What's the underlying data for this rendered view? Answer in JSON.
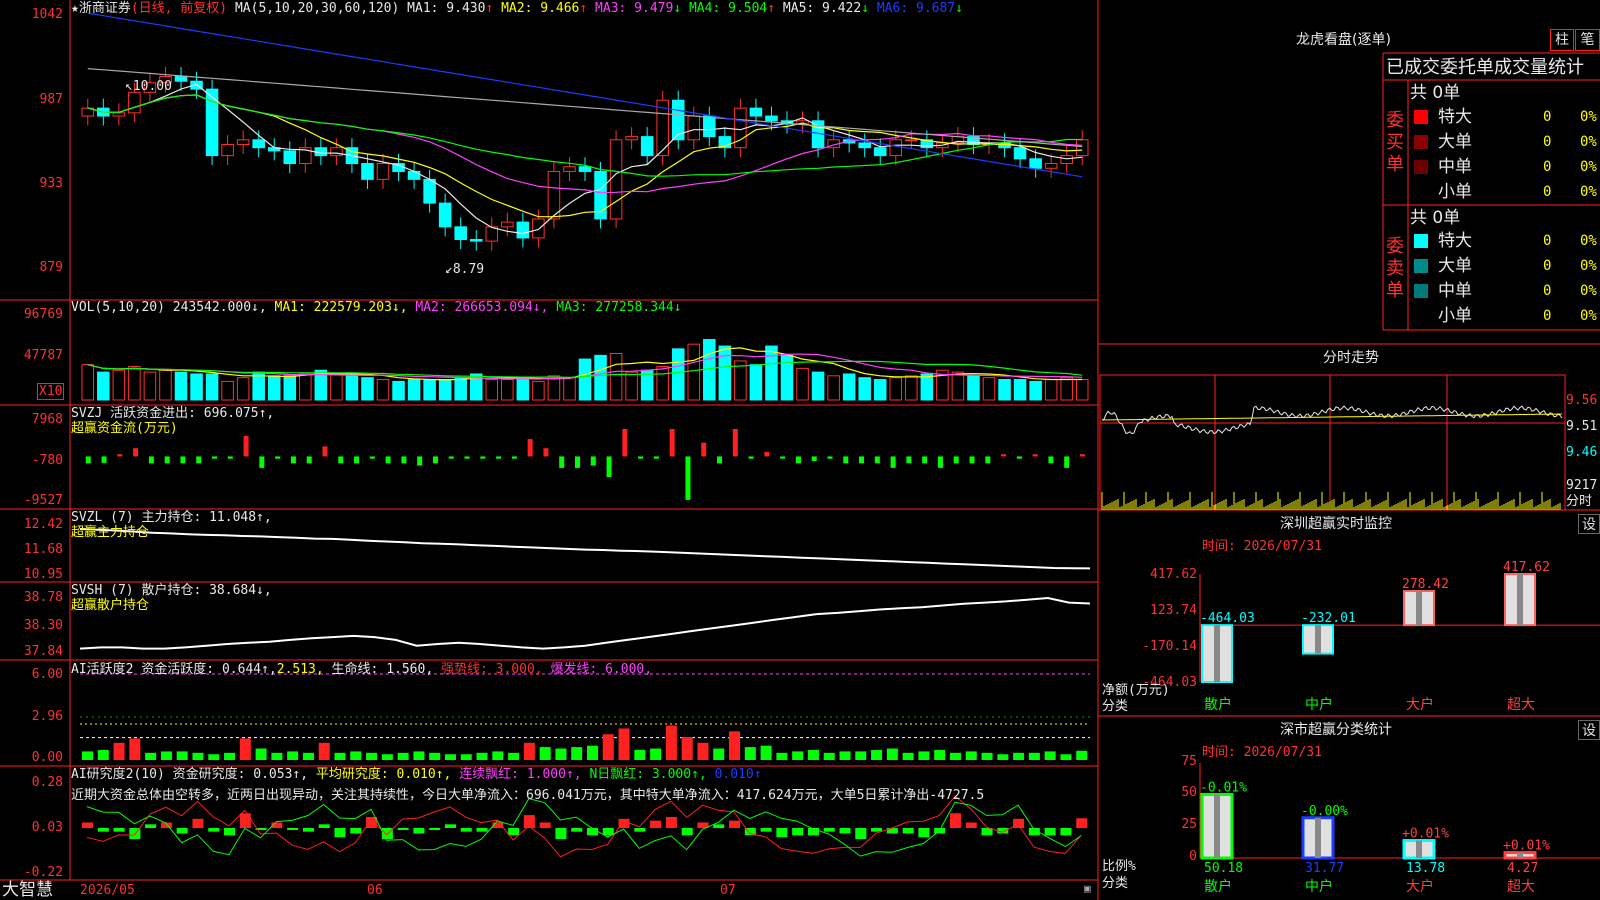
{
  "app": {
    "brand": "大智慧"
  },
  "chart": {
    "stock": "★浙商证券",
    "mode": "(日线, 前复权)",
    "ma_label": "MA(5,10,20,30,60,120)",
    "ma_values": [
      {
        "label": "MA1:",
        "value": "9.430",
        "dir": "↑"
      },
      {
        "label": "MA2:",
        "value": "9.466",
        "dir": "↑"
      },
      {
        "label": "MA3:",
        "value": "9.479",
        "dir": "↓"
      },
      {
        "label": "MA4:",
        "value": "9.504",
        "dir": "↑"
      },
      {
        "label": "MA5:",
        "value": "9.422",
        "dir": "↓"
      },
      {
        "label": "MA6:",
        "value": "9.687",
        "dir": "↓"
      }
    ],
    "price_axis": [
      "1042",
      "987",
      "933",
      "879"
    ],
    "high_marker": "10.00",
    "low_marker": "8.79",
    "date_labels": [
      "2026/05",
      "06",
      "07"
    ]
  },
  "vol": {
    "label": "VOL(5,10,20)",
    "value": "243542.000↓,",
    "ma1": "MA1: 222579.203↓,",
    "ma2": "MA2: 266653.094↓,",
    "ma3": "MA3: 277258.344↓",
    "axis": [
      "96769",
      "47787"
    ],
    "unit": "X10"
  },
  "svzj": {
    "label": "SVZJ  活跃资金进出: 696.075↑,",
    "sub": "超赢资金流(万元)",
    "axis": [
      "7968",
      "-780",
      "-9527"
    ]
  },
  "svzl": {
    "label": "SVZL (7) 主力持仓: 11.048↑,",
    "sub": "超赢主力持仓",
    "axis": [
      "12.42",
      "11.68",
      "10.95"
    ]
  },
  "svsh": {
    "label": "SVSH (7) 散户持仓: 38.684↓,",
    "sub": "超赢散户持仓",
    "axis": [
      "38.78",
      "38.30",
      "37.84"
    ]
  },
  "ai_active": {
    "label": "AI活跃度2 资金活跃度: 0.644↑,",
    "v2": "2.513,",
    "life": "生命线: 1.560,",
    "strong": "强势线: 3.000,",
    "burst": "爆发线: 6.000,",
    "axis": [
      "6.00",
      "2.96",
      "0.00"
    ]
  },
  "ai_research": {
    "label": "AI研究度2(10) 资金研究度: 0.053↑,",
    "avg": "平均研究度: 0.010↑,",
    "consec": "连续飘红: 1.000↑,",
    "nday": "N日飘红: 3.000↑,",
    "last": "0.010↑",
    "axis": [
      "0.28",
      "0.03",
      "-0.22"
    ],
    "commentary": "近期大资金总体由空转多，近两日出现异动，关注其持续性，今日大单净流入：696.041万元，其中特大单净流入：417.624万元，大单5日累计净出-4727.5"
  },
  "dragon": {
    "title": "龙虎看盘(逐单)",
    "btn_bar": "柱",
    "btn_pen": "笔",
    "tabs": "已成交委托单成交量统计",
    "buy_label": "委买单",
    "sell_label": "委卖单",
    "buy_total": "共 0单",
    "sell_total": "共 0单",
    "buy_rows": [
      {
        "name": "特大",
        "count": "0",
        "pct": "0%",
        "color": "#ff0000"
      },
      {
        "name": "大单",
        "count": "0",
        "pct": "0%",
        "color": "#8b0000"
      },
      {
        "name": "中单",
        "count": "0",
        "pct": "0%",
        "color": "#6a0000"
      },
      {
        "name": "小单",
        "count": "0",
        "pct": "0%",
        "color": ""
      }
    ],
    "sell_rows": [
      {
        "name": "特大",
        "count": "0",
        "pct": "0%",
        "color": "#00ffff"
      },
      {
        "name": "大单",
        "count": "0",
        "pct": "0%",
        "color": "#008b8b"
      },
      {
        "name": "中单",
        "count": "0",
        "pct": "0%",
        "color": "#007a7a"
      },
      {
        "name": "小单",
        "count": "0",
        "pct": "0%",
        "color": ""
      }
    ]
  },
  "intraday": {
    "title": "分时走势",
    "axis": [
      "9.56",
      "9.51",
      "9.46"
    ],
    "vol_max": "9217",
    "vol_label": "分时"
  },
  "monitor": {
    "title": "深圳超赢实时监控",
    "btn": "设",
    "time": "时间: 2026/07/31",
    "axis": [
      "417.62",
      "123.74",
      "-170.14",
      "-464.03"
    ],
    "ylabel": "净额(万元)",
    "xlabel": "分类",
    "categories": [
      "散户",
      "中户",
      "大户",
      "超大"
    ],
    "values": [
      -464.03,
      -232.01,
      278.42,
      417.62
    ],
    "value_labels": [
      "-464.03",
      "-232.01",
      "278.42",
      "417.62"
    ]
  },
  "stats": {
    "title": "深市超赢分类统计",
    "btn": "设",
    "time": "时间: 2026/07/31",
    "axis": [
      "75",
      "50",
      "25",
      "0"
    ],
    "ylabel": "比例%",
    "xlabel": "分类",
    "categories": [
      "散户",
      "中户",
      "大户",
      "超大"
    ],
    "values": [
      50.18,
      31.77,
      13.78,
      4.27
    ],
    "value_labels": [
      "50.18",
      "31.77",
      "13.78",
      "4.27"
    ],
    "change_labels": [
      "-0.01%",
      "-0.00%",
      "+0.01%",
      "+0.01%"
    ]
  },
  "chart_data": [
    {
      "type": "candlestick",
      "title": "★浙商证券",
      "subtitle": "(日线, 前复权)",
      "categories_dates": [
        "2026/05",
        "06",
        "07"
      ],
      "ylim": [
        8.79,
        10.42
      ],
      "high": 10.0,
      "low": 8.79,
      "close": [
        9.8,
        9.75,
        9.77,
        9.9,
        9.96,
        10.0,
        9.97,
        9.92,
        9.5,
        9.57,
        9.6,
        9.55,
        9.53,
        9.45,
        9.55,
        9.5,
        9.55,
        9.45,
        9.35,
        9.45,
        9.4,
        9.35,
        9.2,
        9.05,
        8.97,
        8.96,
        9.05,
        9.08,
        8.98,
        9.1,
        9.4,
        9.43,
        9.4,
        9.1,
        9.6,
        9.62,
        9.5,
        9.85,
        9.6,
        9.75,
        9.62,
        9.55,
        9.8,
        9.75,
        9.72,
        9.7,
        9.72,
        9.55,
        9.6,
        9.58,
        9.55,
        9.5,
        9.6,
        9.6,
        9.55,
        9.58,
        9.62,
        9.57,
        9.58,
        9.55,
        9.48,
        9.42,
        9.45,
        9.5,
        9.6
      ],
      "series": [
        {
          "name": "MA1",
          "values": [
            9.43
          ]
        },
        {
          "name": "MA2",
          "values": [
            9.466
          ]
        },
        {
          "name": "MA3",
          "values": [
            9.479
          ]
        },
        {
          "name": "MA4",
          "values": [
            9.504
          ]
        },
        {
          "name": "MA5",
          "values": [
            9.422
          ]
        },
        {
          "name": "MA6",
          "values": [
            9.687
          ]
        }
      ]
    },
    {
      "type": "bar",
      "title": "VOL(5,10,20)",
      "ylim": [
        0,
        96769
      ],
      "values": [
        38000,
        30000,
        32000,
        36000,
        30000,
        32000,
        30000,
        28000,
        28000,
        20000,
        24000,
        30000,
        26000,
        26000,
        28000,
        32000,
        28000,
        26000,
        24000,
        22000,
        20000,
        22000,
        22000,
        22000,
        24000,
        28000,
        22000,
        22000,
        24000,
        20000,
        26000,
        24000,
        44000,
        48000,
        50000,
        30000,
        32000,
        36000,
        55000,
        60000,
        65000,
        58000,
        42000,
        38000,
        58000,
        48000,
        34000,
        30000,
        26000,
        28000,
        24000,
        22000,
        24000,
        26000,
        28000,
        32000,
        30000,
        26000,
        24000,
        22000,
        22000,
        20000,
        22000,
        24000,
        22000,
        24000
      ]
    },
    {
      "type": "bar",
      "title": "SVZJ 活跃资金进出",
      "ylim": [
        -9527,
        7968
      ],
      "values": [
        -1500,
        -1400,
        500,
        1800,
        -1500,
        -1500,
        -1500,
        -1500,
        -500,
        -500,
        4500,
        -2500,
        -500,
        -1500,
        -1500,
        2200,
        -1500,
        -1500,
        -500,
        -1500,
        -1500,
        -2000,
        -1500,
        -500,
        -500,
        -500,
        -500,
        -500,
        3800,
        1800,
        -2500,
        -2500,
        -2000,
        -4500,
        6000,
        -500,
        -500,
        6000,
        -9500,
        3000,
        -1500,
        6000,
        -500,
        1000,
        -500,
        -1500,
        -1000,
        -500,
        -1500,
        -1500,
        -1500,
        -2500,
        -1500,
        -1500,
        -2500,
        -1500,
        -1500,
        -1500,
        500,
        -500,
        500,
        -1500,
        -2500,
        500
      ]
    },
    {
      "type": "line",
      "title": "SVZL 主力持仓",
      "ylim": [
        10.95,
        12.42
      ],
      "series": [
        {
          "name": "主力持仓",
          "values": [
            12.12,
            12.1,
            12.08,
            12.05,
            12.02,
            12.0,
            11.98,
            11.96,
            11.95,
            11.93,
            11.92,
            11.9,
            11.88,
            11.86,
            11.85,
            11.83,
            11.8,
            11.78,
            11.76,
            11.73,
            11.72,
            11.7,
            11.68,
            11.66,
            11.64,
            11.62,
            11.6,
            11.58,
            11.56,
            11.55,
            11.53,
            11.52,
            11.5,
            11.48,
            11.46,
            11.44,
            11.42,
            11.4,
            11.38,
            11.36,
            11.34,
            11.32,
            11.3,
            11.28,
            11.26,
            11.24,
            11.22,
            11.2,
            11.18,
            11.16,
            11.14,
            11.12,
            11.1,
            11.08,
            11.06,
            11.05,
            11.048
          ]
        }
      ]
    },
    {
      "type": "line",
      "title": "SVSH 散户持仓",
      "ylim": [
        37.84,
        38.78
      ],
      "series": [
        {
          "name": "散户持仓",
          "values": [
            37.9,
            37.92,
            37.92,
            37.9,
            37.9,
            37.92,
            37.95,
            37.98,
            38.0,
            38.02,
            38.05,
            38.08,
            38.1,
            38.12,
            38.1,
            38.05,
            37.95,
            37.98,
            38.0,
            37.98,
            37.95,
            37.92,
            37.9,
            37.92,
            37.95,
            38.0,
            38.05,
            38.1,
            38.15,
            38.2,
            38.25,
            38.3,
            38.35,
            38.4,
            38.45,
            38.5,
            38.52,
            38.55,
            38.58,
            38.6,
            38.62,
            38.65,
            38.68,
            38.7,
            38.72,
            38.75,
            38.78,
            38.7,
            38.684
          ]
        }
      ]
    },
    {
      "type": "bar",
      "title": "AI活跃度2",
      "ylim": [
        0,
        6.0
      ],
      "values": [
        0.6,
        0.7,
        1.2,
        1.5,
        0.5,
        0.6,
        0.6,
        0.5,
        0.4,
        0.5,
        1.5,
        0.8,
        0.5,
        0.6,
        0.5,
        1.2,
        0.5,
        0.6,
        0.5,
        0.4,
        0.5,
        0.6,
        0.5,
        0.4,
        0.4,
        0.5,
        0.6,
        0.5,
        1.2,
        0.9,
        0.8,
        0.9,
        1.0,
        1.8,
        2.2,
        0.7,
        0.8,
        2.4,
        1.6,
        1.2,
        0.8,
        2.0,
        0.9,
        1.0,
        0.5,
        0.6,
        0.7,
        0.5,
        0.6,
        0.6,
        0.7,
        0.8,
        0.5,
        0.6,
        0.7,
        0.5,
        0.6,
        0.5,
        0.4,
        0.5,
        0.5,
        0.6,
        0.4,
        0.644
      ]
    },
    {
      "type": "bar",
      "title": "AI研究度2(10)",
      "ylim": [
        -0.22,
        0.28
      ],
      "values": [
        0.03,
        -0.02,
        -0.02,
        -0.06,
        0.02,
        0.03,
        -0.03,
        0.05,
        -0.02,
        -0.04,
        0.08,
        -0.01,
        0.03,
        -0.01,
        -0.02,
        0.02,
        -0.05,
        -0.03,
        0.06,
        -0.06,
        -0.01,
        -0.03,
        -0.01,
        0.02,
        -0.02,
        -0.02,
        0.03,
        -0.04,
        0.07,
        0.03,
        -0.06,
        -0.02,
        -0.04,
        -0.04,
        0.05,
        -0.02,
        0.04,
        0.06,
        -0.04,
        0.03,
        0.02,
        0.04,
        -0.04,
        -0.02,
        -0.05,
        -0.04,
        -0.04,
        -0.02,
        -0.03,
        -0.06,
        -0.02,
        -0.03,
        -0.03,
        -0.05,
        -0.03,
        0.08,
        0.03,
        -0.04,
        -0.03,
        0.05,
        -0.04,
        -0.04,
        -0.04,
        0.053
      ]
    }
  ]
}
